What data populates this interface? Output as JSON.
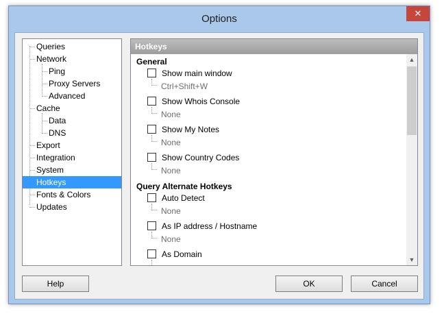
{
  "window": {
    "title": "Options",
    "close_glyph": "✕"
  },
  "tree": {
    "items": [
      {
        "label": "Queries",
        "level": 0
      },
      {
        "label": "Network",
        "level": 0
      },
      {
        "label": "Ping",
        "level": 1
      },
      {
        "label": "Proxy Servers",
        "level": 1
      },
      {
        "label": "Advanced",
        "level": 1
      },
      {
        "label": "Cache",
        "level": 0
      },
      {
        "label": "Data",
        "level": 1
      },
      {
        "label": "DNS",
        "level": 1
      },
      {
        "label": "Export",
        "level": 0
      },
      {
        "label": "Integration",
        "level": 0
      },
      {
        "label": "System",
        "level": 0
      },
      {
        "label": "Hotkeys",
        "level": 0,
        "selected": true
      },
      {
        "label": "Fonts & Colors",
        "level": 0
      },
      {
        "label": "Updates",
        "level": 0
      }
    ]
  },
  "panel": {
    "header": "Hotkeys",
    "groups": [
      {
        "title": "General",
        "items": [
          {
            "label": "Show main window",
            "hotkey": "Ctrl+Shift+W",
            "checked": false
          },
          {
            "label": "Show Whois Console",
            "hotkey": "None",
            "checked": false
          },
          {
            "label": "Show My Notes",
            "hotkey": "None",
            "checked": false
          },
          {
            "label": "Show Country Codes",
            "hotkey": "None",
            "checked": false
          }
        ]
      },
      {
        "title": "Query Alternate Hotkeys",
        "items": [
          {
            "label": "Auto Detect",
            "hotkey": "None",
            "checked": false
          },
          {
            "label": "As IP address / Hostname",
            "hotkey": "None",
            "checked": false
          },
          {
            "label": "As Domain",
            "hotkey": "",
            "checked": false
          }
        ]
      }
    ],
    "scroll_up": "▲",
    "scroll_down": "▼"
  },
  "buttons": {
    "help": "Help",
    "ok": "OK",
    "cancel": "Cancel"
  },
  "colors": {
    "selection": "#3399ff",
    "header_bg": "#a6a6a6",
    "frame": "#a9c8ea"
  }
}
